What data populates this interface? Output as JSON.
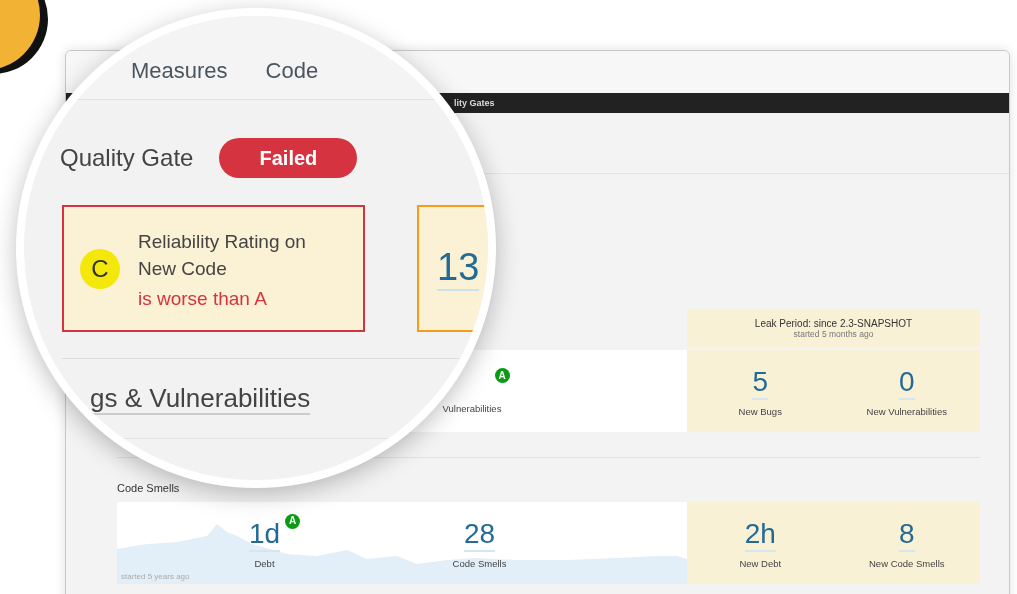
{
  "header": {
    "tabs": [
      {
        "label": "Measures"
      },
      {
        "label": "Code"
      }
    ]
  },
  "nav_bar": {
    "text": "lity Gates"
  },
  "quality_gate": {
    "title": "Quality Gate",
    "status": "Failed",
    "conditions": [
      {
        "kind": "rating",
        "rating": "C",
        "metric": "Reliability Rating on New Code",
        "condition": "is worse than A",
        "color": "#d4333f"
      },
      {
        "kind": "value",
        "value": "13",
        "color": "#f59c1a"
      }
    ]
  },
  "bugs_vulnerabilities": {
    "title": "gs & Vulnerabilities",
    "leak_period": {
      "title": "Leak Period: since 2.3-SNAPSHOT",
      "subtitle": "started 5 months ago"
    },
    "measures": [
      {
        "label": "Vulnerabilities",
        "rating": "A"
      }
    ],
    "leak_measures": [
      {
        "value": "5",
        "label": "New Bugs"
      },
      {
        "value": "0",
        "label": "New Vulnerabilities"
      }
    ]
  },
  "code_smells": {
    "title": "Code Smells",
    "history_note": "started 5 years ago",
    "measures": [
      {
        "value": "1d",
        "label": "Debt",
        "rating": "A"
      },
      {
        "value": "28",
        "label": "Code Smells"
      }
    ],
    "leak_measures": [
      {
        "value": "2h",
        "label": "New Debt"
      },
      {
        "value": "8",
        "label": "New Code Smells"
      }
    ]
  }
}
